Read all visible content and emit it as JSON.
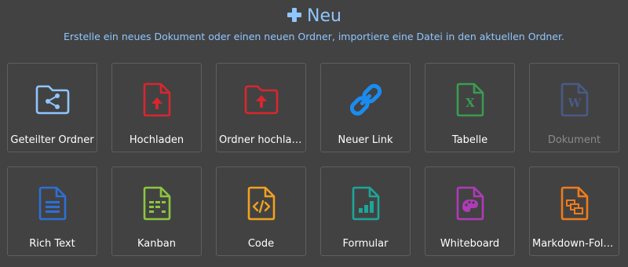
{
  "header": {
    "title": "Neu",
    "subtitle": "Erstelle ein neues Dokument oder einen neuen Ordner, importiere eine Datei in den aktuellen Ordner."
  },
  "colors": {
    "accent": "#8fc6ff",
    "background": "#424242",
    "tile_border": "#5f5f5f"
  },
  "tiles": [
    {
      "label": "Geteilter Ordner",
      "icon": "shared-folder-icon",
      "color": "#8fc6ff",
      "enabled": true
    },
    {
      "label": "Hochladen",
      "icon": "upload-file-icon",
      "color": "#d9262f",
      "enabled": true
    },
    {
      "label": "Ordner hochladen",
      "icon": "upload-folder-icon",
      "color": "#d9262f",
      "enabled": true
    },
    {
      "label": "Neuer Link",
      "icon": "link-icon",
      "color": "#1a8cf0",
      "enabled": true
    },
    {
      "label": "Tabelle",
      "icon": "spreadsheet-icon",
      "color": "#3a9b52",
      "enabled": true
    },
    {
      "label": "Dokument",
      "icon": "word-document-icon",
      "color": "#4a5a86",
      "enabled": false
    },
    {
      "label": "Rich Text",
      "icon": "rich-text-icon",
      "color": "#2d6fd6",
      "enabled": true
    },
    {
      "label": "Kanban",
      "icon": "kanban-icon",
      "color": "#8dc63f",
      "enabled": true
    },
    {
      "label": "Code",
      "icon": "code-icon",
      "color": "#f0a11f",
      "enabled": true
    },
    {
      "label": "Formular",
      "icon": "form-icon",
      "color": "#1da59a",
      "enabled": true
    },
    {
      "label": "Whiteboard",
      "icon": "whiteboard-icon",
      "color": "#b03ab8",
      "enabled": true
    },
    {
      "label": "Markdown-Folien",
      "icon": "slides-icon",
      "color": "#f07c1a",
      "enabled": true
    }
  ]
}
